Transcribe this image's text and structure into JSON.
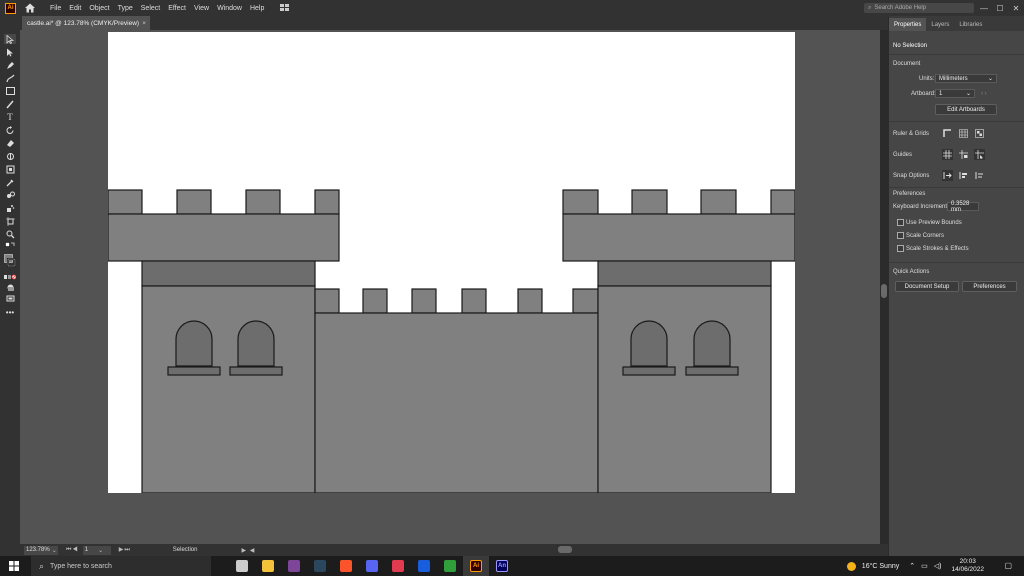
{
  "app": {
    "logo_text": "Ai",
    "menu": [
      "File",
      "Edit",
      "Object",
      "Type",
      "Select",
      "Effect",
      "View",
      "Window",
      "Help"
    ],
    "help_search_placeholder": "Search Adobe Help",
    "window_controls": [
      "—",
      "☐",
      "✕"
    ]
  },
  "document": {
    "tab_title": "castle.ai* @ 123.78% (CMYK/Preview)",
    "tab_close": "×"
  },
  "status_bar": {
    "zoom": "123.78%",
    "artboard": "1",
    "tool": "Selection"
  },
  "panel": {
    "tabs": [
      "Properties",
      "Layers",
      "Libraries"
    ],
    "no_selection": "No Selection",
    "document_heading": "Document",
    "units_label": "Units:",
    "units_value": "Millimeters",
    "artboard_label": "Artboard:",
    "artboard_value": "1",
    "edit_artboards": "Edit Artboards",
    "rulers_grids": "Ruler & Grids",
    "guides": "Guides",
    "snap_options": "Snap Options",
    "preferences_heading": "Preferences",
    "keyboard_increment_label": "Keyboard Increment:",
    "keyboard_increment_value": "0.3528 mm",
    "use_preview_bounds": "Use Preview Bounds",
    "scale_corners": "Scale Corners",
    "scale_strokes": "Scale Strokes & Effects",
    "quick_actions": "Quick Actions",
    "document_setup": "Document Setup",
    "preferences_button": "Preferences"
  },
  "taskbar": {
    "search_placeholder": "Type here to search",
    "apps": [
      {
        "name": "task-view",
        "color": "#cccccc",
        "label": ""
      },
      {
        "name": "file-explorer",
        "color": "#f3c13a",
        "label": ""
      },
      {
        "name": "tor-browser",
        "color": "#7d4698",
        "label": ""
      },
      {
        "name": "steam",
        "color": "#2a475e",
        "label": ""
      },
      {
        "name": "brave",
        "color": "#fb542b",
        "label": ""
      },
      {
        "name": "discord",
        "color": "#5865f2",
        "label": ""
      },
      {
        "name": "red-app",
        "color": "#e23a4f",
        "label": ""
      },
      {
        "name": "bitwarden",
        "color": "#175ddc",
        "label": ""
      },
      {
        "name": "xbox",
        "color": "#2f9e3b",
        "label": ""
      },
      {
        "name": "illustrator",
        "color": "#330000",
        "label": "Ai"
      },
      {
        "name": "animate",
        "color": "#00005b",
        "label": "An"
      }
    ],
    "weather": "16°C  Sunny",
    "time": "20:03",
    "date": "14/06/2022"
  },
  "colors": {
    "castle_fill": "#808080",
    "castle_dark": "#6d6d6d",
    "outline": "#1a1a1a",
    "accent": "#ff9a00"
  }
}
